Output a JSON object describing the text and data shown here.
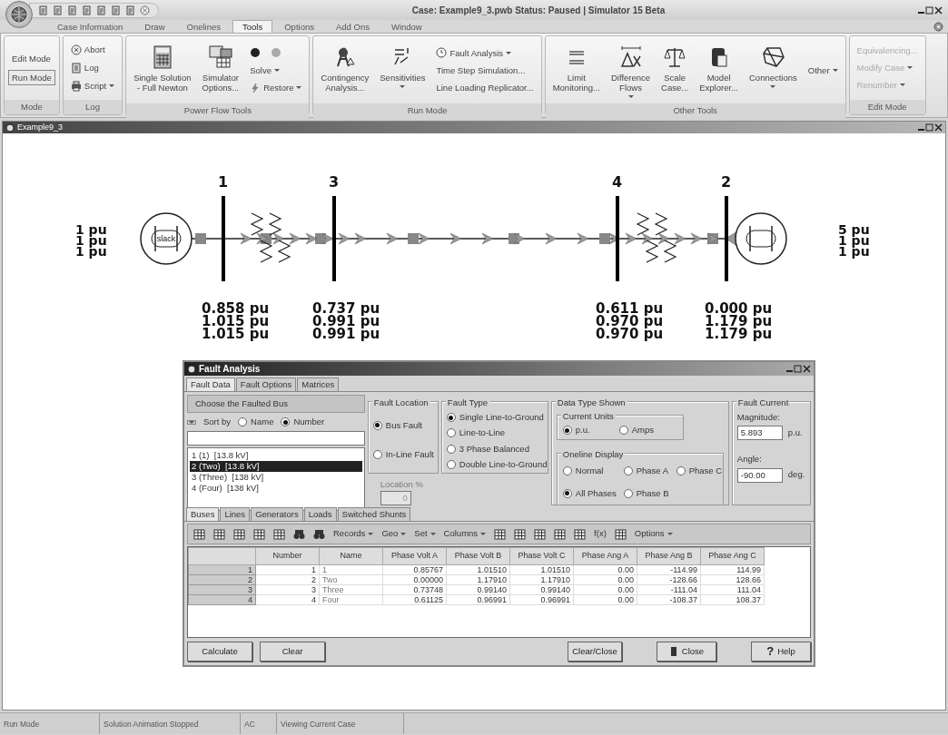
{
  "window": {
    "title": "Case: Example9_3.pwb  Status: Paused | Simulator 15 Beta"
  },
  "ribbon_tabs": [
    {
      "label": "Case Information",
      "selected": false
    },
    {
      "label": "Draw",
      "selected": false
    },
    {
      "label": "Onelines",
      "selected": false
    },
    {
      "label": "Tools",
      "selected": true
    },
    {
      "label": "Options",
      "selected": false
    },
    {
      "label": "Add Ons",
      "selected": false
    },
    {
      "label": "Window",
      "selected": false
    }
  ],
  "ribbon_groups": [
    {
      "title": "Mode",
      "disabled": false,
      "columns": [
        [
          {
            "kind": "mode",
            "label": "Edit Mode",
            "selected": false
          },
          {
            "kind": "mode",
            "label": "Run Mode",
            "selected": true
          }
        ]
      ]
    },
    {
      "title": "Log",
      "disabled": false,
      "columns": [
        [
          {
            "kind": "small",
            "label": "Abort",
            "dropdown": false
          },
          {
            "kind": "small",
            "label": "Log",
            "dropdown": false
          },
          {
            "kind": "small",
            "label": "Script",
            "dropdown": true
          }
        ]
      ]
    },
    {
      "title": "Power Flow Tools",
      "disabled": false,
      "columns": [
        [
          {
            "kind": "large",
            "label": "Single Solution\n- Full Newton",
            "dropdown": false
          }
        ],
        [
          {
            "kind": "large",
            "label": "Simulator\nOptions...",
            "dropdown": false
          }
        ],
        [
          {
            "kind": "play-controls"
          },
          {
            "kind": "small",
            "label": "Solve",
            "dropdown": true
          },
          {
            "kind": "small",
            "label": "Restore",
            "dropdown": true
          }
        ]
      ]
    },
    {
      "title": "Run Mode",
      "disabled": false,
      "columns": [
        [
          {
            "kind": "large",
            "label": "Contingency\nAnalysis...",
            "dropdown": false
          }
        ],
        [
          {
            "kind": "large",
            "label": "Sensitivities",
            "dropdown": true
          }
        ],
        [
          {
            "kind": "small",
            "label": "Fault Analysis",
            "dropdown": true
          },
          {
            "kind": "small",
            "label": "Time Step Simulation...",
            "dropdown": false
          },
          {
            "kind": "small",
            "label": "Line Loading Replicator...",
            "dropdown": false
          }
        ]
      ]
    },
    {
      "title": "Other Tools",
      "disabled": false,
      "columns": [
        [
          {
            "kind": "large",
            "label": "Limit\nMonitoring...",
            "dropdown": false
          }
        ],
        [
          {
            "kind": "large",
            "label": "Difference\nFlows",
            "dropdown": true
          }
        ],
        [
          {
            "kind": "large",
            "label": "Scale\nCase...",
            "dropdown": false
          }
        ],
        [
          {
            "kind": "large",
            "label": "Model\nExplorer...",
            "dropdown": false
          }
        ],
        [
          {
            "kind": "large",
            "label": "Connections",
            "dropdown": true
          }
        ],
        [
          {
            "kind": "small",
            "label": "Other",
            "dropdown": true
          }
        ]
      ]
    },
    {
      "title": "Edit Mode",
      "disabled": true,
      "columns": [
        [
          {
            "kind": "small",
            "label": "Equivalencing...",
            "dropdown": false
          },
          {
            "kind": "small",
            "label": "Modify Case",
            "dropdown": true
          },
          {
            "kind": "small",
            "label": "Renumber",
            "dropdown": true
          }
        ]
      ]
    }
  ],
  "oneline": {
    "title": "Example9_3",
    "generators": [
      {
        "label": "slack",
        "readings": [
          "1 pu",
          "1 pu",
          "1 pu"
        ]
      },
      {
        "readings": [
          "5 pu",
          "1 pu",
          "1 pu"
        ]
      }
    ],
    "buses": [
      {
        "number": "1",
        "readings": [
          "0.858 pu",
          "1.015 pu",
          "1.015 pu"
        ]
      },
      {
        "number": "3",
        "readings": [
          "0.737 pu",
          "0.991 pu",
          "0.991 pu"
        ]
      },
      {
        "number": "4",
        "readings": [
          "0.611 pu",
          "0.970 pu",
          "0.970 pu"
        ]
      },
      {
        "number": "2",
        "readings": [
          "0.000 pu",
          "1.179 pu",
          "1.179 pu"
        ]
      }
    ]
  },
  "fault_dialog": {
    "title": "Fault Analysis",
    "tabs": [
      {
        "label": "Fault Data",
        "selected": true
      },
      {
        "label": "Fault Options",
        "selected": false
      },
      {
        "label": "Matrices",
        "selected": false
      }
    ],
    "bus_chooser": {
      "title": "Choose the Faulted Bus",
      "sort_label": "Sort by",
      "sort_options": [
        {
          "label": "Name",
          "selected": false
        },
        {
          "label": "Number",
          "selected": true
        }
      ],
      "buses": [
        {
          "label": "1 (1)  [13.8 kV]",
          "selected": false
        },
        {
          "label": "2 (Two)  [13.8 kV]",
          "selected": true
        },
        {
          "label": "3 (Three)  [138 kV]",
          "selected": false
        },
        {
          "label": "4 (Four)  [138 kV]",
          "selected": false
        }
      ]
    },
    "fault_location": {
      "title": "Fault Location",
      "options": [
        {
          "label": "Bus Fault",
          "selected": true
        },
        {
          "label": "In-Line Fault",
          "selected": false
        }
      ],
      "location": {
        "label": "Location %",
        "value": "0",
        "disabled": true
      }
    },
    "fault_type": {
      "title": "Fault Type",
      "options": [
        {
          "label": "Single Line-to-Ground",
          "selected": true
        },
        {
          "label": "Line-to-Line",
          "selected": false
        },
        {
          "label": "3 Phase Balanced",
          "selected": false
        },
        {
          "label": "Double Line-to-Ground",
          "selected": false
        }
      ]
    },
    "data_type": {
      "title": "Data Type Shown",
      "current_units": {
        "title": "Current Units",
        "options": [
          {
            "label": "p.u.",
            "selected": true
          },
          {
            "label": "Amps",
            "selected": false
          }
        ]
      },
      "oneline_display": {
        "title": "Oneline Display",
        "options": [
          {
            "label": "Normal",
            "selected": false
          },
          {
            "label": "Phase A",
            "selected": false
          },
          {
            "label": "Phase C",
            "selected": false
          },
          {
            "label": "All Phases",
            "selected": true
          },
          {
            "label": "Phase B",
            "selected": false
          }
        ]
      }
    },
    "fault_current": {
      "title": "Fault Current",
      "magnitude_label": "Magnitude:",
      "magnitude": "5.893",
      "magnitude_unit": "p.u.",
      "angle_label": "Angle:",
      "angle": "-90.00",
      "angle_unit": "deg."
    },
    "result_tabs": [
      {
        "label": "Buses",
        "selected": true
      },
      {
        "label": "Lines",
        "selected": false
      },
      {
        "label": "Generators",
        "selected": false
      },
      {
        "label": "Loads",
        "selected": false
      },
      {
        "label": "Switched Shunts",
        "selected": false
      }
    ],
    "toolbar": [
      {
        "kind": "menu",
        "label": "Records"
      },
      {
        "kind": "menu",
        "label": "Geo"
      },
      {
        "kind": "menu",
        "label": "Set"
      },
      {
        "kind": "menu",
        "label": "Columns"
      },
      {
        "kind": "text",
        "label": "f(x)"
      },
      {
        "kind": "menu",
        "label": "Options"
      }
    ],
    "table": {
      "columns": [
        "Number",
        "Name",
        "Phase Volt A",
        "Phase Volt B",
        "Phase Volt C",
        "Phase Ang A",
        "Phase Ang B",
        "Phase Ang C"
      ],
      "rows": [
        {
          "header": "1",
          "cells": [
            "1",
            "1",
            "0.85767",
            "1.01510",
            "1.01510",
            "0.00",
            "-114.99",
            "114.99"
          ]
        },
        {
          "header": "2",
          "cells": [
            "2",
            "Two",
            "0.00000",
            "1.17910",
            "1.17910",
            "0.00",
            "-128.66",
            "128.66"
          ]
        },
        {
          "header": "3",
          "cells": [
            "3",
            "Three",
            "0.73748",
            "0.99140",
            "0.99140",
            "0.00",
            "-111.04",
            "111.04"
          ]
        },
        {
          "header": "4",
          "cells": [
            "4",
            "Four",
            "0.61125",
            "0.96991",
            "0.96991",
            "0.00",
            "-108.37",
            "108.37"
          ]
        }
      ]
    },
    "buttons": [
      {
        "kind": "left",
        "label": "Calculate"
      },
      {
        "kind": "left",
        "label": "Clear"
      },
      {
        "kind": "right",
        "label": "Clear/Close"
      },
      {
        "kind": "close",
        "label": "Close"
      },
      {
        "kind": "help",
        "glyph": "?",
        "label": "Help"
      }
    ]
  },
  "status_bar": [
    "Run Mode",
    "Solution Animation Stopped",
    "AC",
    "Viewing Current Case"
  ]
}
